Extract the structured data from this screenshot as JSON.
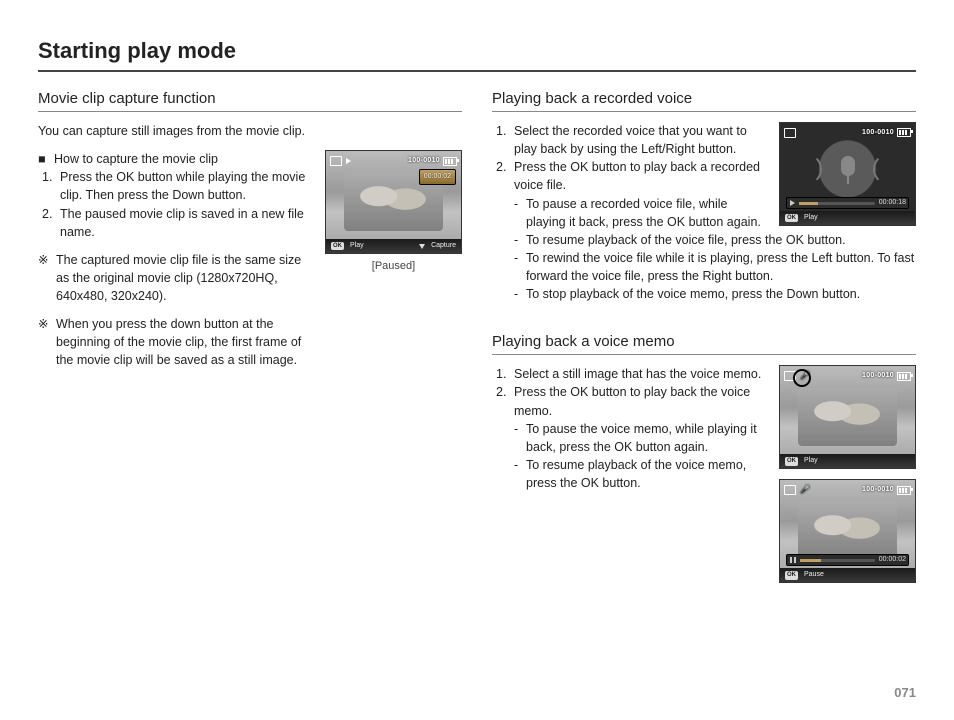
{
  "page_title": "Starting play mode",
  "page_number": "071",
  "left": {
    "section1": {
      "heading": "Movie clip capture function",
      "intro": "You can capture still images from the movie clip.",
      "howto_heading": "How to capture the movie clip",
      "step1": "Press the OK button while playing the movie clip. Then press the Down button.",
      "step2": "The paused movie clip is saved in a new file name.",
      "note1": "The captured movie clip file is the same size as the original movie clip (1280x720HQ, 640x480, 320x240).",
      "note2": "When you press the down button at the beginning of the movie clip, the first frame of the movie clip will be saved as a still image.",
      "caption": "[Paused]",
      "thumb": {
        "title": "100-0010",
        "time": "00:00:02",
        "play_label": "Play",
        "capture_label": "Capture",
        "ok": "OK"
      }
    }
  },
  "right": {
    "section1": {
      "heading": "Playing back a recorded voice",
      "step1": "Select the recorded voice that you want to play back by using the Left/Right button.",
      "step2": "Press the OK button to play back a recorded voice file.",
      "sub1": "To pause a recorded voice file, while playing it back, press the OK button again.",
      "sub2": "To resume playback of the voice file, press the OK button.",
      "sub3": "To rewind the voice file while it is playing, press the Left button. To fast forward the voice file, press the Right button.",
      "sub4": "To stop playback of the voice memo, press the Down button.",
      "thumb": {
        "title": "100-0010",
        "time": "00:00:18",
        "play_label": "Play",
        "ok": "OK"
      }
    },
    "section2": {
      "heading": "Playing back a voice memo",
      "step1": "Select a still image that has the voice memo.",
      "step2": "Press the OK button to play back the voice memo.",
      "sub1": "To pause the voice memo, while playing it back, press the OK button again.",
      "sub2": "To resume playback of the voice memo, press the OK button.",
      "thumb1": {
        "title": "100-0010",
        "play_label": "Play",
        "ok": "OK"
      },
      "thumb2": {
        "title": "100-0010",
        "time": "00:00:02",
        "pause_label": "Pause",
        "ok": "OK"
      }
    }
  }
}
